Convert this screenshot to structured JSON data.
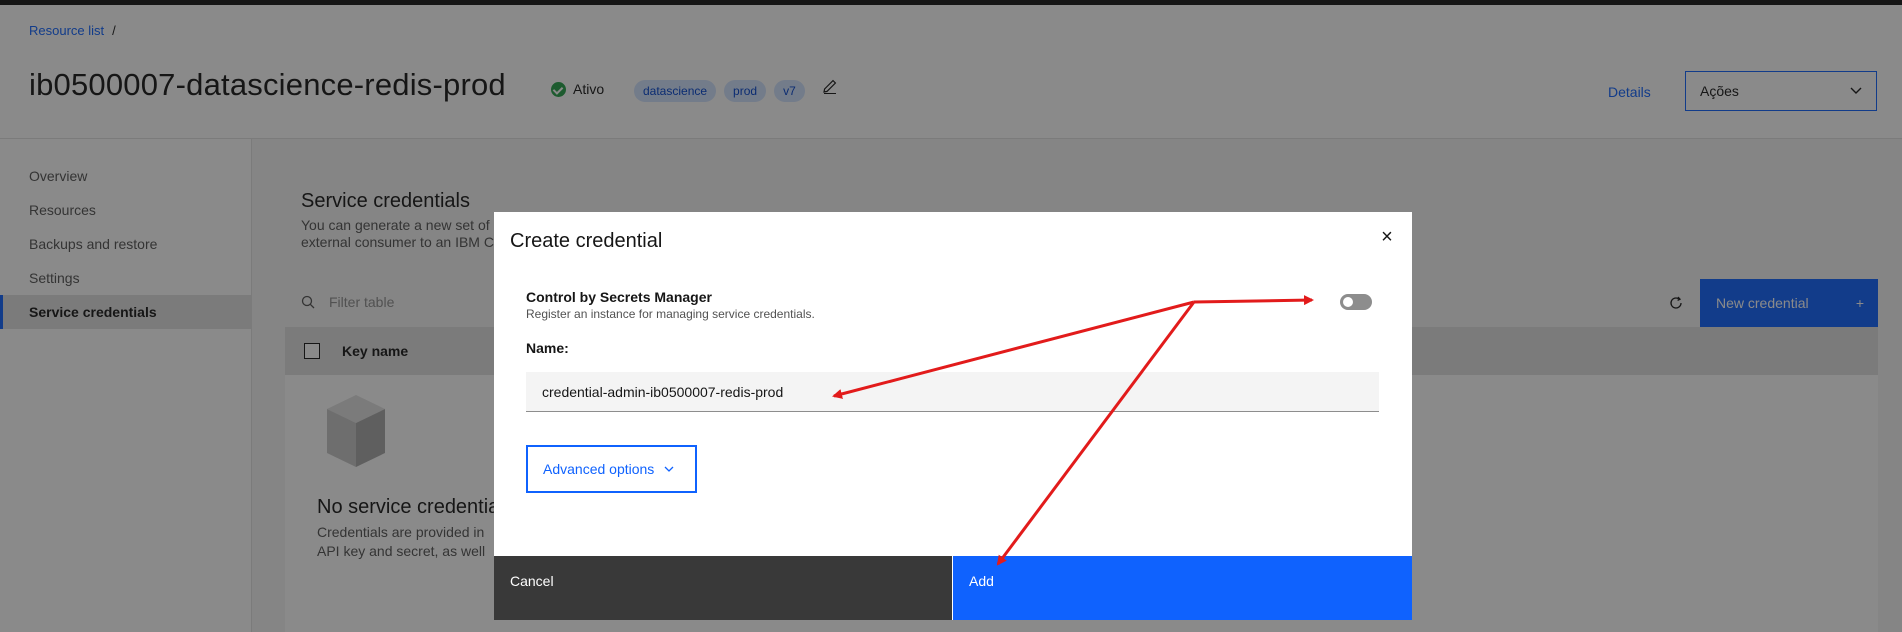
{
  "breadcrumb": {
    "root": "Resource list",
    "separator": "/"
  },
  "header": {
    "title": "ib0500007-datascience-redis-prod",
    "status": "Ativo",
    "tags": [
      "datascience",
      "prod",
      "v7"
    ],
    "details_link": "Details",
    "actions_label": "Ações"
  },
  "sidebar": {
    "items": [
      {
        "label": "Overview"
      },
      {
        "label": "Resources"
      },
      {
        "label": "Backups and restore"
      },
      {
        "label": "Settings"
      },
      {
        "label": "Service credentials"
      }
    ],
    "active_index": 4
  },
  "card": {
    "title": "Service credentials",
    "description_line1": "You can generate a new set of",
    "description_line2": "external consumer to an IBM C",
    "filter_placeholder": "Filter table",
    "new_credential_label": "New credential",
    "new_credential_icon": "+",
    "column_key_name": "Key name",
    "empty_title": "No service credentia",
    "empty_desc_line1": "Credentials are provided in",
    "empty_desc_line2": "API key and secret, as well"
  },
  "modal": {
    "title": "Create credential",
    "close_icon": "×",
    "control_label": "Control by Secrets Manager",
    "control_help": "Register an instance for managing service credentials.",
    "toggle_on": false,
    "name_label": "Name:",
    "name_value": "credential-admin-ib0500007-redis-prod",
    "advanced_label": "Advanced options",
    "cancel_label": "Cancel",
    "add_label": "Add"
  },
  "colors": {
    "primary": "#0f62fe",
    "status_green": "#24a148",
    "annotation_red": "#e21b1b",
    "tag_bg": "#d0e2ff",
    "cancel_bg": "#393939"
  }
}
